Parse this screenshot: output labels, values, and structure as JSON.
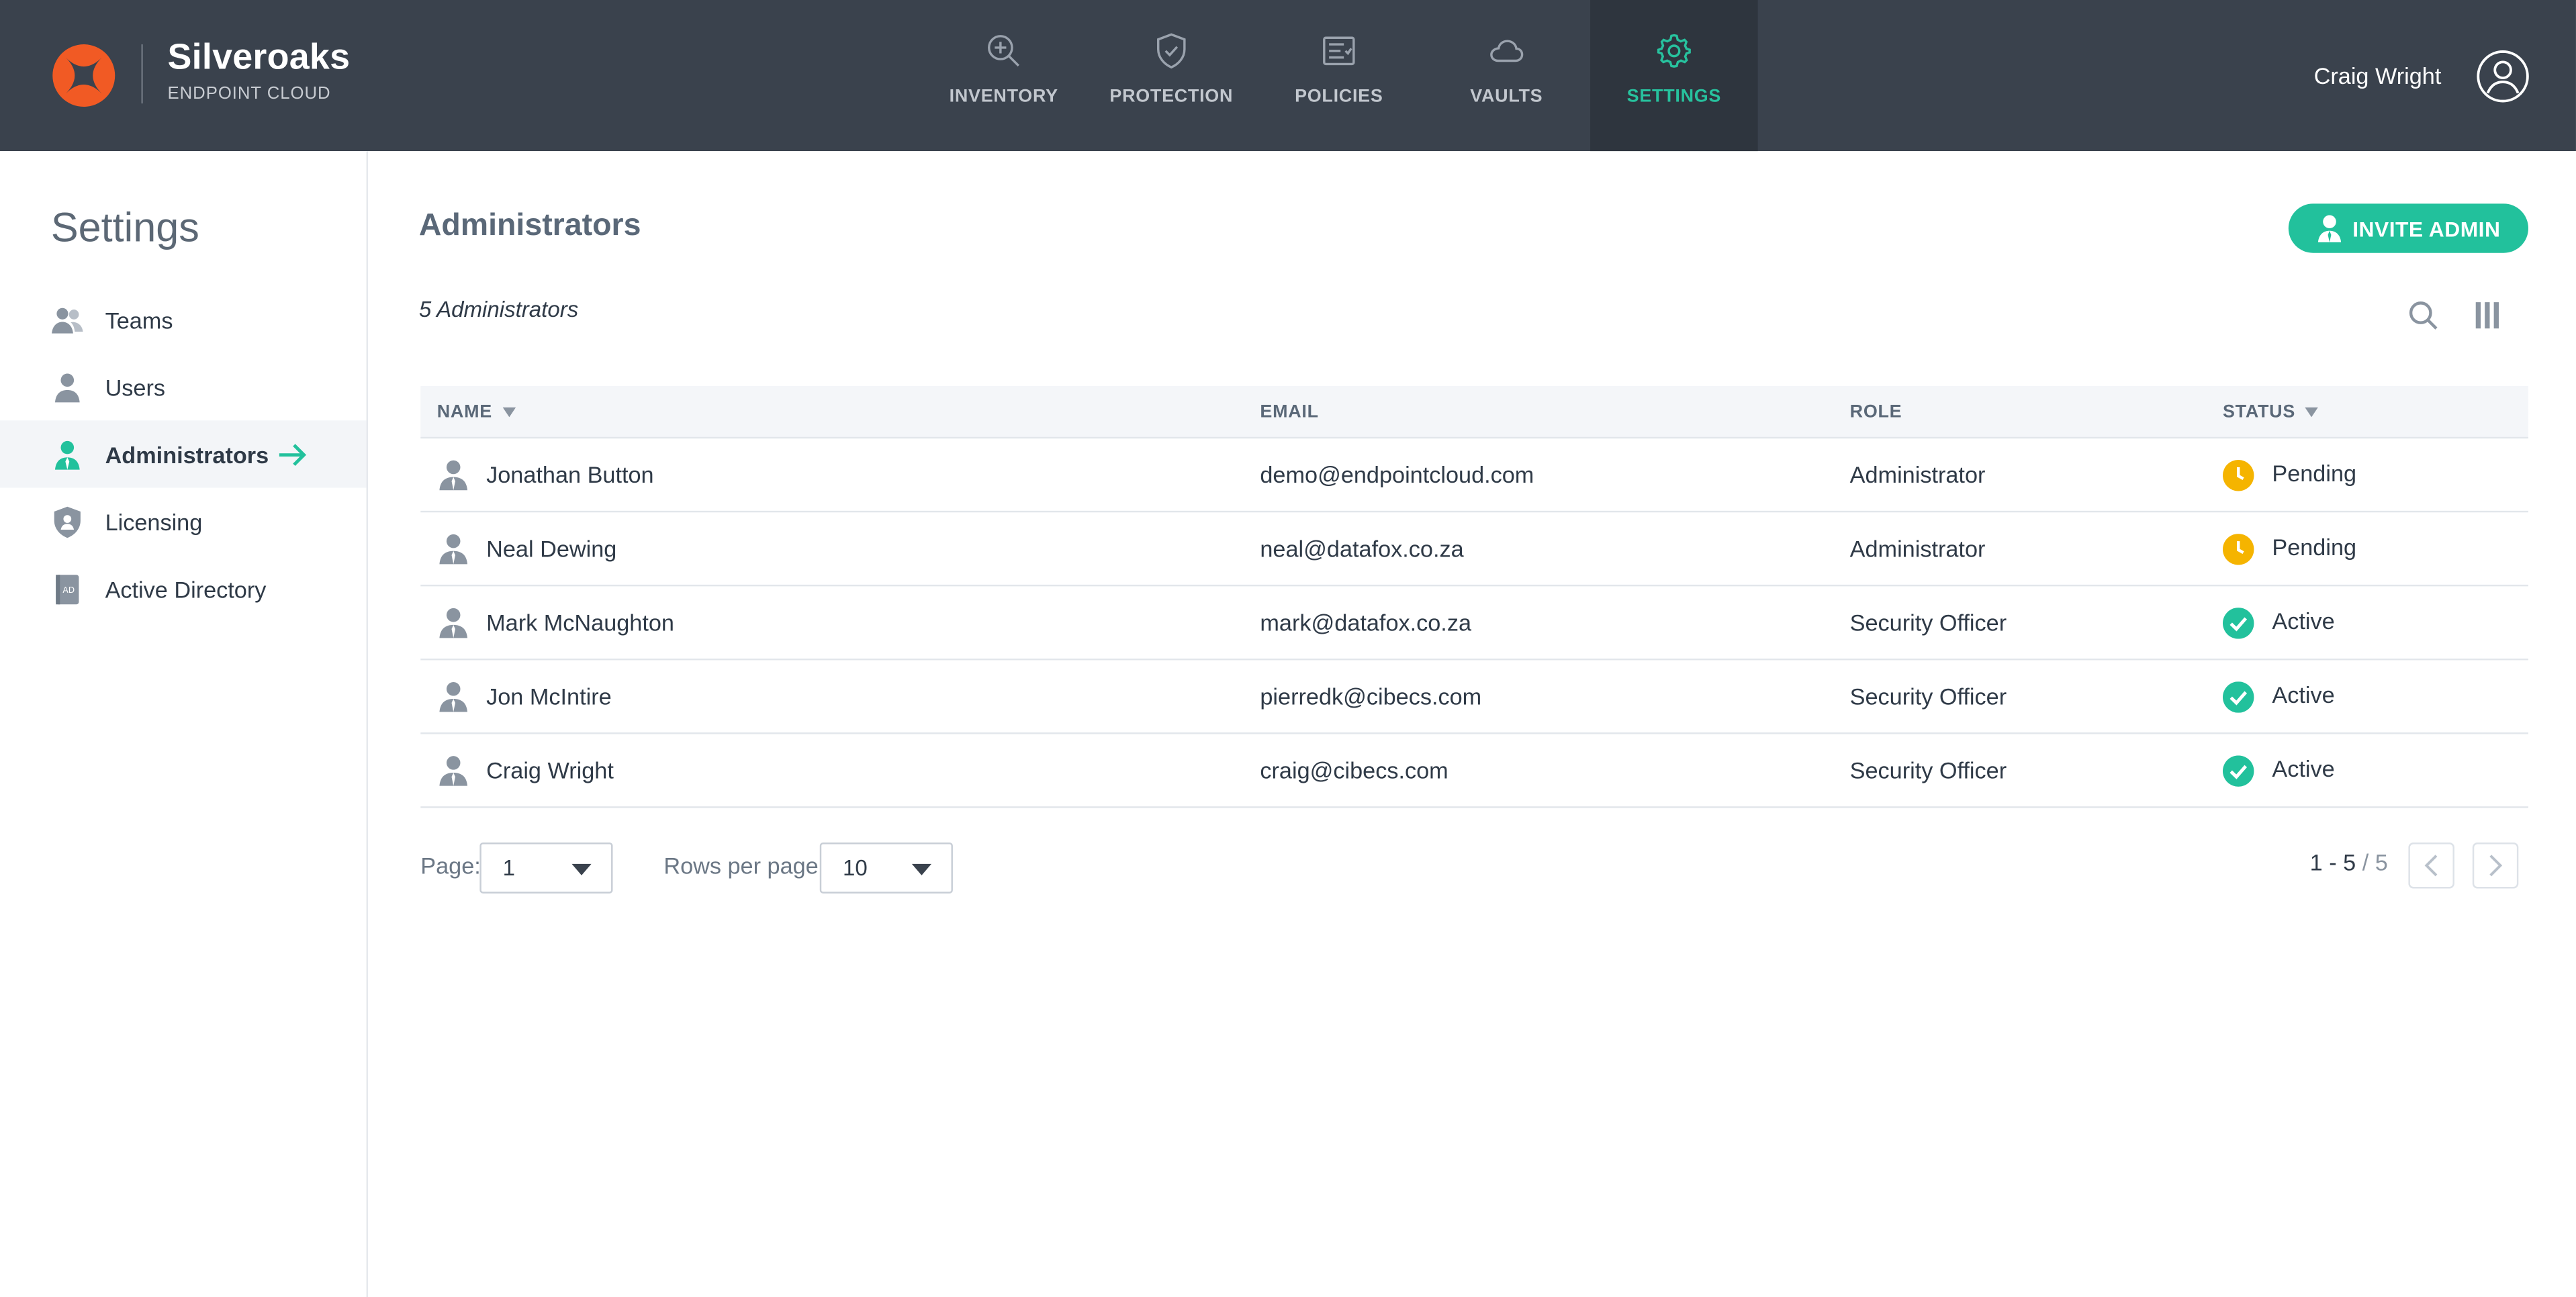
{
  "header": {
    "brand_name": "Silveroaks",
    "brand_sub": "ENDPOINT CLOUD",
    "nav": [
      {
        "label": "INVENTORY",
        "icon": "inventory-search-icon"
      },
      {
        "label": "PROTECTION",
        "icon": "shield-check-icon"
      },
      {
        "label": "POLICIES",
        "icon": "policies-list-icon"
      },
      {
        "label": "VAULTS",
        "icon": "cloud-icon"
      },
      {
        "label": "SETTINGS",
        "icon": "gear-icon",
        "active": true
      }
    ],
    "user_name": "Craig Wright"
  },
  "sidebar": {
    "title": "Settings",
    "items": [
      {
        "label": "Teams",
        "icon": "teams-icon"
      },
      {
        "label": "Users",
        "icon": "user-icon"
      },
      {
        "label": "Administrators",
        "icon": "admin-icon",
        "active": true
      },
      {
        "label": "Licensing",
        "icon": "licensing-shield-icon"
      },
      {
        "label": "Active Directory",
        "icon": "active-directory-icon"
      }
    ]
  },
  "main": {
    "title": "Administrators",
    "invite_label": "INVITE ADMIN",
    "count_label": "5 Administrators",
    "columns": {
      "name": "NAME",
      "email": "EMAIL",
      "role": "ROLE",
      "status": "STATUS"
    },
    "rows": [
      {
        "name": "Jonathan Button",
        "email": "demo@endpointcloud.com",
        "role": "Administrator",
        "status": "Pending"
      },
      {
        "name": "Neal Dewing",
        "email": "neal@datafox.co.za",
        "role": "Administrator",
        "status": "Pending"
      },
      {
        "name": "Mark McNaughton",
        "email": "mark@datafox.co.za",
        "role": "Security Officer",
        "status": "Active"
      },
      {
        "name": "Jon McIntire",
        "email": "pierredk@cibecs.com",
        "role": "Security Officer",
        "status": "Active"
      },
      {
        "name": "Craig Wright",
        "email": "craig@cibecs.com",
        "role": "Security Officer",
        "status": "Active"
      }
    ],
    "pagination": {
      "page_label": "Page:",
      "page_value": "1",
      "rows_label": "Rows per page:",
      "rows_value": "10",
      "range": "1 - 5",
      "total": "/ 5"
    }
  },
  "colors": {
    "topbar": "#3a424d",
    "accent": "#22c19c",
    "pending": "#f5b400",
    "active": "#22c19c",
    "logo": "#f15a24"
  }
}
